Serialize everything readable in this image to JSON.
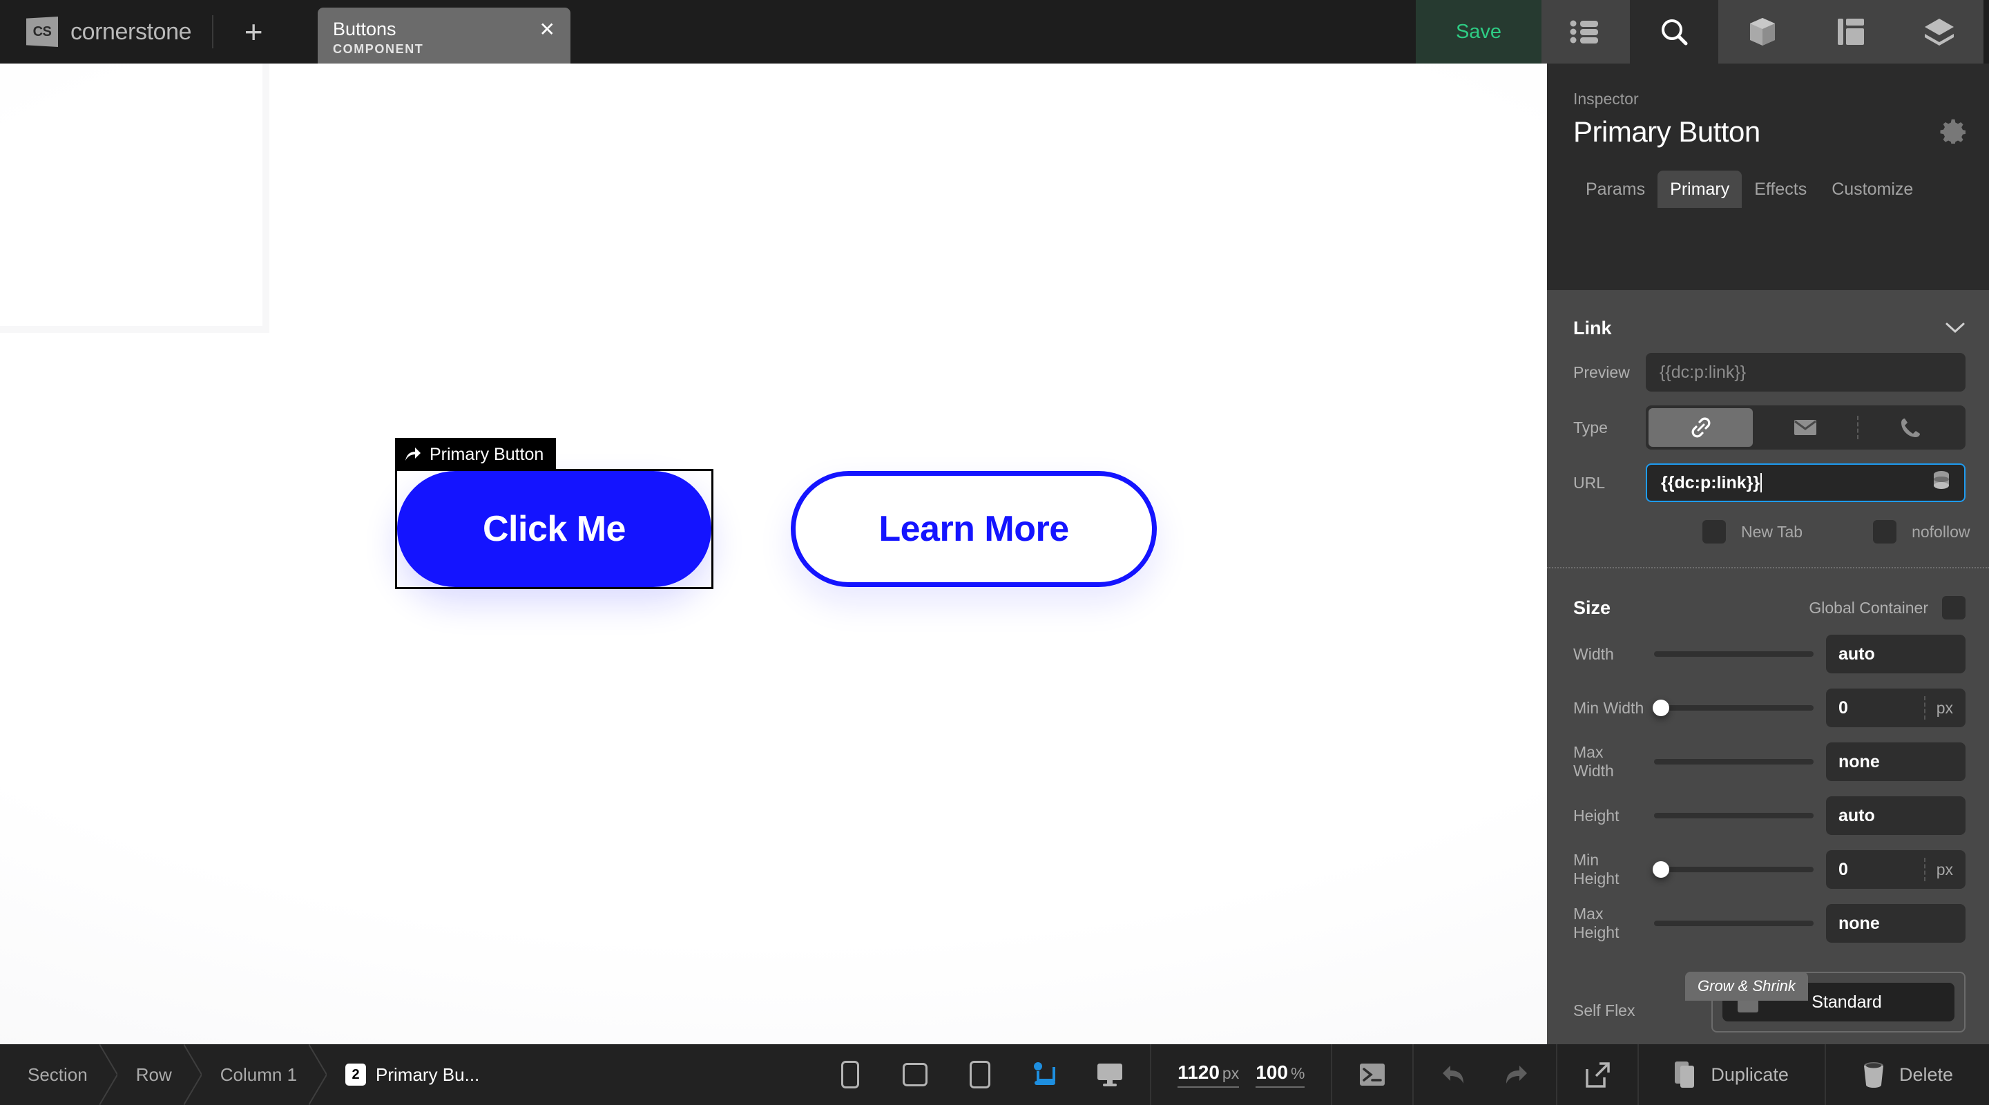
{
  "topbar": {
    "logo_text": "CS",
    "brand": "cornerstone",
    "add_icon": "plus-icon",
    "document_tab": {
      "title": "Buttons",
      "subtitle": "COMPONENT",
      "close_icon": "close-icon"
    },
    "save_label": "Save",
    "tools": [
      {
        "name": "list-icon",
        "state": "inactive"
      },
      {
        "name": "search-icon",
        "state": "active"
      },
      {
        "name": "box-icon",
        "state": "inactive"
      },
      {
        "name": "layout-icon",
        "state": "inactive"
      },
      {
        "name": "layers-icon",
        "state": "inactive"
      }
    ]
  },
  "canvas": {
    "selection_label": "Primary Button",
    "selection_icon": "arrow-share-icon",
    "primary_button_label": "Click Me",
    "secondary_button_label": "Learn More",
    "primary_button_color": "#1414ff",
    "secondary_button_color": "#1414ff"
  },
  "inspector": {
    "eyebrow": "Inspector",
    "title": "Primary Button",
    "settings_icon": "gear-icon",
    "tabs": [
      {
        "label": "Params",
        "active": false
      },
      {
        "label": "Primary",
        "active": true
      },
      {
        "label": "Effects",
        "active": false
      },
      {
        "label": "Customize",
        "active": false
      }
    ],
    "link_section": {
      "title": "Link",
      "collapse_icon": "chevron-down-icon",
      "preview_label": "Preview",
      "preview_value": "{{dc:p:link}}",
      "type_label": "Type",
      "type_options": [
        {
          "name": "link-icon",
          "active": true
        },
        {
          "name": "mail-icon",
          "active": false
        },
        {
          "name": "phone-icon",
          "active": false
        }
      ],
      "url_label": "URL",
      "url_value": "{{dc:p:link}}",
      "url_dynamic_icon": "database-icon",
      "new_tab_label": "New Tab",
      "new_tab_checked": false,
      "nofollow_label": "nofollow",
      "nofollow_checked": false
    },
    "size_section": {
      "title": "Size",
      "global_container_label": "Global Container",
      "global_container_checked": false,
      "rows": [
        {
          "label": "Width",
          "value": "auto",
          "unit": "",
          "slider": false
        },
        {
          "label": "Min Width",
          "value": "0",
          "unit": "px",
          "slider": true
        },
        {
          "label": "Max Width",
          "value": "none",
          "unit": "",
          "slider": false
        },
        {
          "label": "Height",
          "value": "auto",
          "unit": "",
          "slider": false
        },
        {
          "label": "Min Height",
          "value": "0",
          "unit": "px",
          "slider": true
        },
        {
          "label": "Max Height",
          "value": "none",
          "unit": "",
          "slider": false
        }
      ],
      "grow_shrink_tab": "Grow & Shrink",
      "self_flex_label": "Self Flex",
      "self_flex_value": "Standard"
    }
  },
  "bottombar": {
    "breadcrumbs": [
      {
        "label": "Section",
        "badge": "",
        "active": false
      },
      {
        "label": "Row",
        "badge": "",
        "active": false
      },
      {
        "label": "Column 1",
        "badge": "",
        "active": false
      },
      {
        "label": "Primary Bu...",
        "badge": "2",
        "active": true
      }
    ],
    "viewports": [
      {
        "name": "mobile-portrait-icon",
        "active": false
      },
      {
        "name": "mobile-landscape-icon",
        "active": false
      },
      {
        "name": "tablet-icon",
        "active": false
      },
      {
        "name": "laptop-icon",
        "active": true
      },
      {
        "name": "desktop-icon",
        "active": false
      }
    ],
    "canvas_width": "1120",
    "canvas_width_unit": "px",
    "zoom_level": "100",
    "zoom_unit": "%",
    "code_icon": "code-icon",
    "undo_icon": "undo-icon",
    "redo_icon": "redo-icon",
    "preview_icon": "external-link-icon",
    "duplicate_label": "Duplicate",
    "duplicate_icon": "duplicate-icon",
    "delete_label": "Delete",
    "delete_icon": "trash-icon"
  }
}
